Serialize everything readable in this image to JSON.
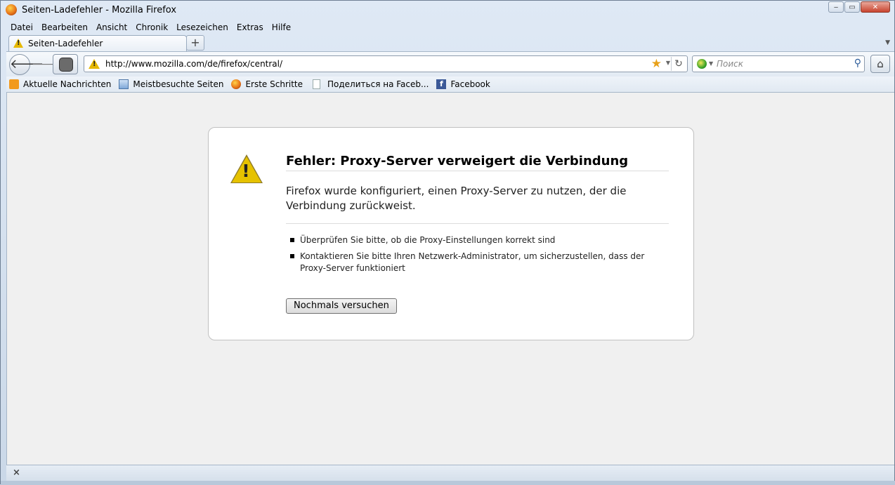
{
  "window": {
    "title": "Seiten-Ladefehler - Mozilla Firefox",
    "minimize": "‒",
    "maximize": "▭",
    "close": "✕"
  },
  "menu": [
    "Datei",
    "Bearbeiten",
    "Ansicht",
    "Chronik",
    "Lesezeichen",
    "Extras",
    "Hilfe"
  ],
  "tabs": {
    "active_label": "Seiten-Ladefehler",
    "new_tab": "+",
    "list_arrow": "▼"
  },
  "nav": {
    "back": "🡐",
    "forward": "🡒",
    "url": "http://www.mozilla.com/de/firefox/central/",
    "star": "★",
    "dropmarker": "▼",
    "reload": "↻",
    "search_placeholder": "Поиск",
    "search_go": "⚲",
    "engine_drop": "▼",
    "home": "⌂"
  },
  "bookmarks": [
    {
      "label": "Aktuelle Nachrichten",
      "icon": "rss-icon"
    },
    {
      "label": "Meistbesuchte Seiten",
      "icon": "most-visited-icon"
    },
    {
      "label": "Erste Schritte",
      "icon": "firefox-icon"
    },
    {
      "label": "Поделиться на Faceb...",
      "icon": "page-icon"
    },
    {
      "label": "Facebook",
      "icon": "facebook-icon",
      "glyph": "f"
    }
  ],
  "error": {
    "title": "Fehler: Proxy-Server verweigert die Verbindung",
    "description": "Firefox wurde konfiguriert, einen Proxy-Server zu nutzen, der die Verbindung zurückweist.",
    "items": [
      "Überprüfen Sie bitte, ob die Proxy-Einstellungen korrekt sind",
      "Kontaktieren Sie bitte Ihren Netzwerk-Administrator, um sicherzustellen, dass der Proxy-Server funktioniert"
    ],
    "warning_mark": "!",
    "retry_label": "Nochmals versuchen"
  },
  "status": {
    "close": "×"
  },
  "colors": {
    "warning": "#e6c200",
    "content_bg": "#f0f0f0",
    "facebook": "#3b5998"
  }
}
